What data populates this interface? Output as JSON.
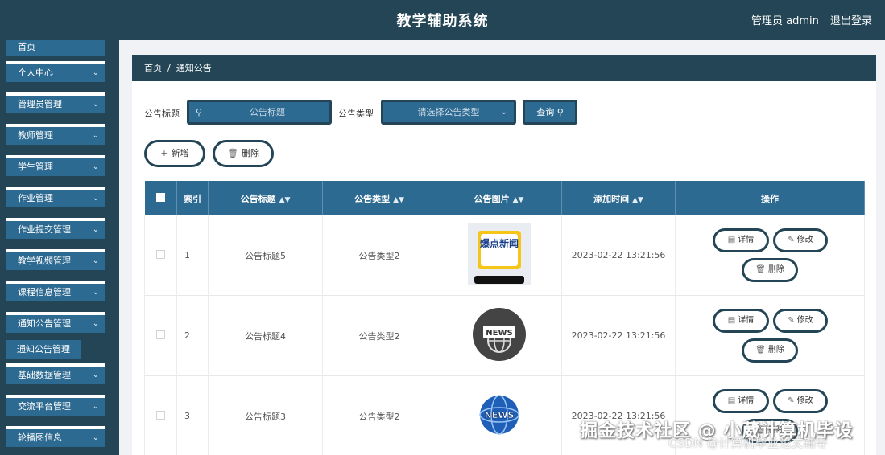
{
  "header": {
    "title": "教学辅助系统",
    "admin": "管理员 admin",
    "logout": "退出登录"
  },
  "sidebar": {
    "items": [
      {
        "label": "首页"
      },
      {
        "label": "个人中心"
      },
      {
        "label": "管理员管理"
      },
      {
        "label": "教师管理"
      },
      {
        "label": "学生管理"
      },
      {
        "label": "作业管理"
      },
      {
        "label": "作业提交管理"
      },
      {
        "label": "教学视频管理"
      },
      {
        "label": "课程信息管理"
      },
      {
        "label": "通知公告管理"
      },
      {
        "label": "基础数据管理"
      },
      {
        "label": "交流平台管理"
      },
      {
        "label": "轮播图信息"
      }
    ],
    "active_sub": "通知公告管理"
  },
  "breadcrumb": {
    "home": "首页",
    "sep": "/",
    "current": "通知公告"
  },
  "filters": {
    "title_label": "公告标题",
    "title_placeholder": "公告标题",
    "type_label": "公告类型",
    "type_placeholder": "请选择公告类型",
    "query_button": "查询"
  },
  "actions": {
    "add": "新增",
    "delete": "删除"
  },
  "table": {
    "headers": {
      "index": "索引",
      "title": "公告标题",
      "type": "公告类型",
      "image": "公告图片",
      "time": "添加时间",
      "ops": "操作"
    },
    "rows": [
      {
        "index": "1",
        "title": "公告标题5",
        "type": "公告类型2",
        "image_text": "爆点新闻",
        "time": "2023-02-22 13:21:56"
      },
      {
        "index": "2",
        "title": "公告标题4",
        "type": "公告类型2",
        "image_text": "NEWS",
        "time": "2023-02-22 13:21:56"
      },
      {
        "index": "3",
        "title": "公告标题3",
        "type": "公告类型2",
        "image_text": "NEWS",
        "time": "2023-02-22 13:21:56"
      }
    ],
    "row_actions": {
      "detail": "详情",
      "edit": "修改",
      "delete": "删除"
    }
  },
  "watermark": {
    "line1": "掘金技术社区 @ 小葳计算机毕设",
    "line2": "CSDN @计算机毕业论文辅导"
  },
  "icons": {
    "search": "search-icon",
    "chevron": "chevron-down-icon",
    "plus": "plus-icon",
    "trash": "trash-icon",
    "detail": "document-icon",
    "edit": "pencil-icon"
  },
  "colors": {
    "primary_dark": "#234556",
    "primary": "#2d6a91",
    "background": "#f0f2f5"
  }
}
